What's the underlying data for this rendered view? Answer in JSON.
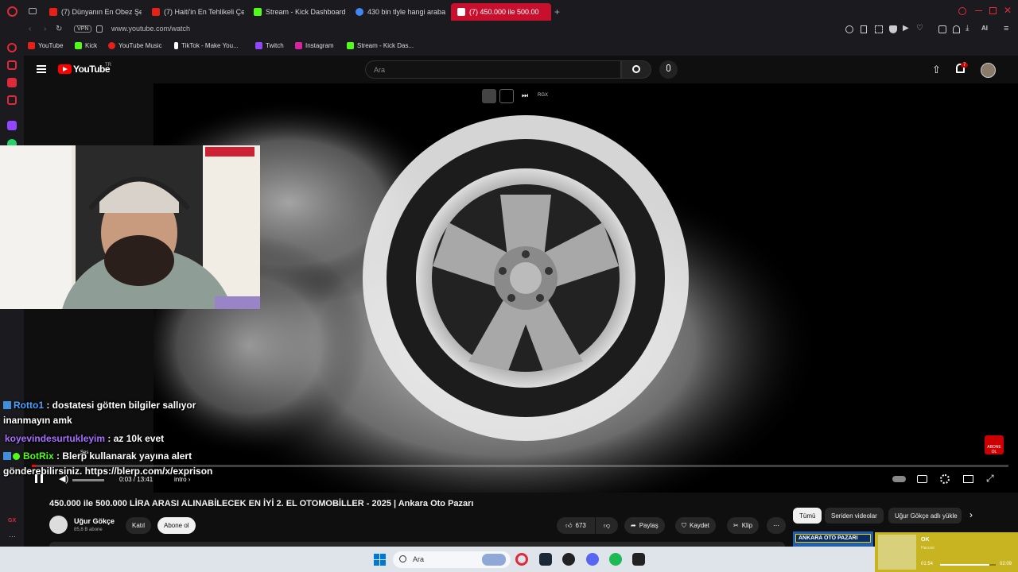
{
  "browser": {
    "tabs": [
      {
        "label": "(7) Dünyanın En Obez Şeh",
        "color": "#e62117"
      },
      {
        "label": "(7) Haiti'in En Tehlikeli Çet",
        "color": "#e62117"
      },
      {
        "label": "Stream - Kick Dashboard",
        "color": "#53fc18"
      },
      {
        "label": "430 bin tlyle hangi araba a",
        "color": "#4285f4"
      },
      {
        "label": "(7) 450.000 ile 500.00",
        "color": "#ffffff"
      }
    ],
    "url": "www.youtube.com/watch",
    "vpn_label": "VPN",
    "ai_label": "AI",
    "bookmarks": [
      {
        "label": "YouTube",
        "color": "#e62117"
      },
      {
        "label": "Kick",
        "color": "#53fc18"
      },
      {
        "label": "YouTube Music",
        "color": "#e62117"
      },
      {
        "label": "TikTok - Make You...",
        "color": "#ffffff"
      },
      {
        "label": "Twitch",
        "color": "#9146ff"
      },
      {
        "label": "Instagram",
        "color": "#d6249f"
      },
      {
        "label": "Stream - Kick Das...",
        "color": "#53fc18"
      }
    ]
  },
  "youtube": {
    "logo_text": "YouTube",
    "region": "TR",
    "search_placeholder": "Ara",
    "notifications": "7",
    "overlay_label": "RGX",
    "subscribe_badge": "ABONE OL"
  },
  "stream_chat": [
    {
      "user": "Rotto1",
      "user_color": "#4aa3ff",
      "text": ": dostatesi götten bilgiler sallıyor",
      "badge": true
    },
    {
      "user": "",
      "user_color": "#ffffff",
      "text": "inanmayın amk",
      "badge": false
    },
    {
      "user": "koyevindesurtukleyim",
      "user_color": "#a970ff",
      "text": ": az 10k evet",
      "badge": false
    },
    {
      "user": "BotRix",
      "user_color": "#53fc18",
      "text": ": Blerp kullanarak yayına alert",
      "badge": true
    },
    {
      "user": "",
      "user_color": "#ffffff",
      "text": "gönderebilirsiniz. https://blerp.com/x/exprison",
      "badge": false
    }
  ],
  "player": {
    "time": "0:03 / 13:41",
    "chapter": "intro",
    "volume_tooltip": "Ses",
    "progress": 0.004
  },
  "video": {
    "title": "450.000 ile 500.000 LİRA ARASI ALINABİLECEK EN İYİ 2. EL OTOMOBİLLER - 2025 | Ankara Oto Pazarı",
    "channel": "Uğur Gökçe",
    "subscribers": "85,8 B abone",
    "join_label": "Katıl",
    "subscribe_label": "Abone ol",
    "likes": "673",
    "share_label": "Paylaş",
    "save_label": "Kaydet",
    "clip_label": "Klip"
  },
  "chips": [
    "Tümü",
    "Seriden videolar",
    "Uğur Gökçe adlı yükle"
  ],
  "thumbnail_text": "ANKARA OTO PAZARI",
  "taskbar": {
    "search_placeholder": "Ara"
  },
  "media_widget": {
    "title": "OK",
    "subtitle": "Hacızer",
    "current": "01:54",
    "total": "02:09",
    "progress": 0.88
  }
}
